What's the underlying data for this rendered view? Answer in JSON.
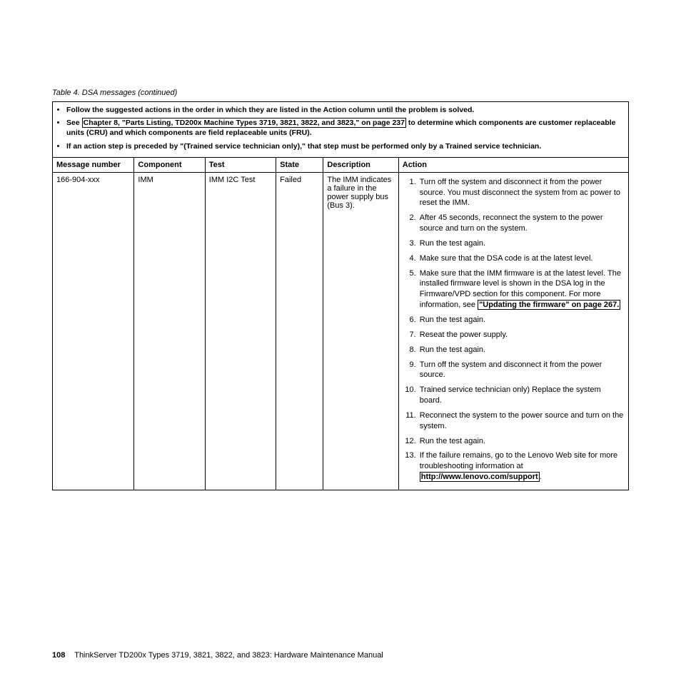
{
  "caption": "Table 4. DSA messages  (continued)",
  "instructions": {
    "i1": "Follow the suggested actions in the order in which they are listed in the Action column until the problem is solved.",
    "i2a": "See ",
    "i2link": "Chapter 8, \"Parts Listing, TD200x Machine Types 3719, 3821, 3822, and 3823,\" on page 237",
    "i2b": " to determine which components are customer replaceable units (CRU) and which components are field replaceable units (FRU).",
    "i3": "If an action step is preceded by \"(Trained service technician only),\" that step must be performed only by a Trained service technician."
  },
  "headers": {
    "h1": "Message number",
    "h2": "Component",
    "h3": "Test",
    "h4": "State",
    "h5": "Description",
    "h6": "Action"
  },
  "row": {
    "msgnum": "166-904-xxx",
    "component": "IMM",
    "test": "IMM I2C Test",
    "state": "Failed",
    "description": "The IMM indicates a failure in the power supply bus (Bus 3).",
    "actions": {
      "a1": "Turn off the system and disconnect it from the power source. You must disconnect the system from ac power to reset the IMM.",
      "a2": "After 45 seconds, reconnect the system to the power source and turn on the system.",
      "a3": "Run the test again.",
      "a4": "Make sure that the DSA code is at the latest level.",
      "a5a": "Make sure that the IMM firmware is at the latest level. The installed firmware level is shown in the DSA log in the Firmware/VPD section for this component. For more information, see ",
      "a5link": "\"Updating the firmware\" on page 267.",
      "a6": "Run the test again.",
      "a7": "Reseat the power supply.",
      "a8": "Run the test again.",
      "a9": "Turn off the system and disconnect it from the power source.",
      "a10": "Trained service technician only) Replace the system board.",
      "a11": "Reconnect the system to the power source and turn on the system.",
      "a12": "Run the test again.",
      "a13a": "If the failure remains, go to the Lenovo Web site for more troubleshooting information at ",
      "a13link": "http://www.lenovo.com/support"
    }
  },
  "footer": {
    "pagenum": "108",
    "title": "ThinkServer TD200x Types 3719, 3821, 3822, and 3823:  Hardware Maintenance Manual"
  }
}
